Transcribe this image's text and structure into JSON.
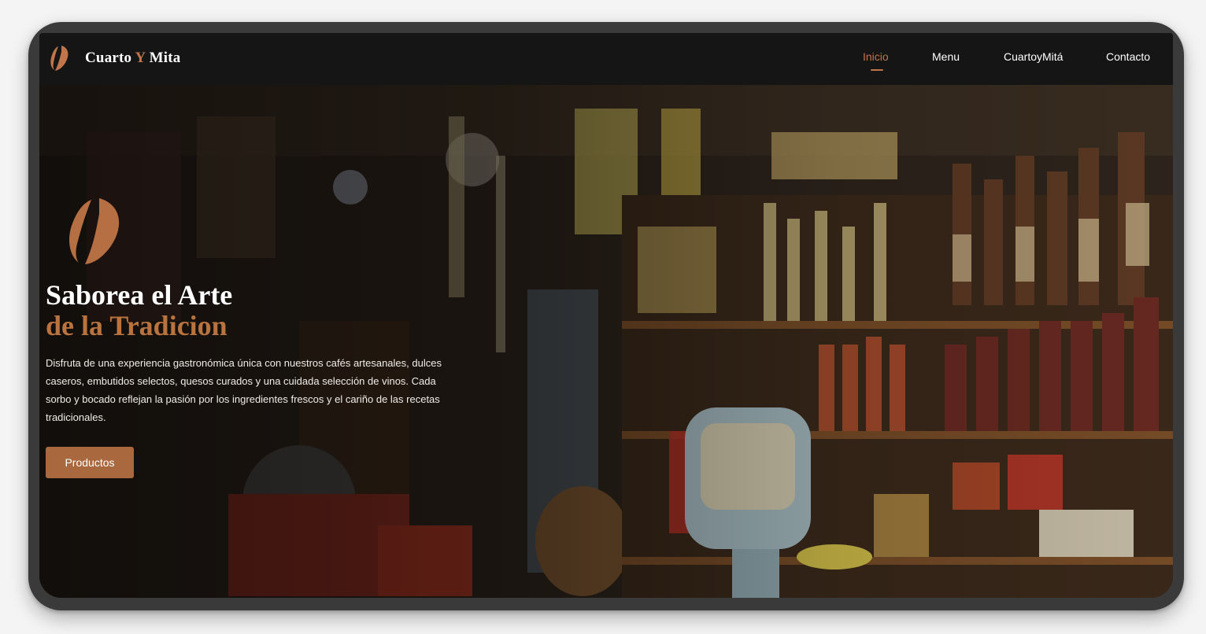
{
  "brand": {
    "name_part1": "Cuarto",
    "name_accent": "Y",
    "name_part2": "Mita",
    "logo_icon": "coffee-bean-icon"
  },
  "nav": {
    "items": [
      {
        "label": "Inicio",
        "active": true
      },
      {
        "label": "Menu",
        "active": false
      },
      {
        "label": "CuartoyMitá",
        "active": false
      },
      {
        "label": "Contacto",
        "active": false
      }
    ]
  },
  "hero": {
    "icon": "coffee-bean-icon",
    "headline_line1": "Saborea el Arte",
    "headline_line2": "de la Tradicion",
    "description": "Disfruta de una experiencia gastronómica única con nuestros cafés artesanales, dulces caseros, embutidos selectos, quesos curados y una cuidada selección de vinos. Cada sorbo y bocado reflejan la pasión por los ingredientes frescos y el cariño de las recetas tradicionales.",
    "cta_label": "Productos"
  },
  "colors": {
    "accent": "#c0764a",
    "button": "#a9683d",
    "navbar": "#151515",
    "frame": "#3a3a3a"
  }
}
